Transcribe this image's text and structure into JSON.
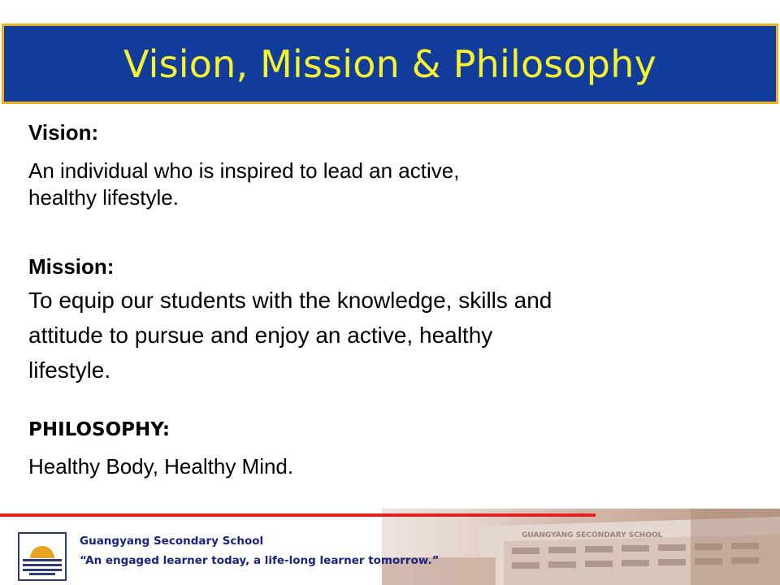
{
  "slide": {
    "title": "Vision, Mission & Philosophy",
    "vision": {
      "heading": "Vision:",
      "lines": [
        "An individual who is inspired to lead an active,",
        "healthy lifestyle."
      ]
    },
    "mission": {
      "heading": "Mission:",
      "lines": [
        "To equip our students with the knowledge, skills and",
        "attitude to pursue and enjoy an active, healthy",
        "lifestyle."
      ]
    },
    "philosophy": {
      "heading": "PHILOSOPHY:",
      "text": "Healthy Body, Healthy Mind."
    }
  },
  "footer": {
    "school_name": "Guangyang Secondary School",
    "motto": "“An engaged learner today, a life-long learner tomorrow.”",
    "building_sign": "GUANGYANG SECONDARY SCHOOL"
  },
  "colors": {
    "title_background": "#123c9b",
    "title_border": "#e8b31f",
    "title_text": "#f6f32e",
    "footer_rule": "#e0231e",
    "footer_text": "#1a237e"
  }
}
